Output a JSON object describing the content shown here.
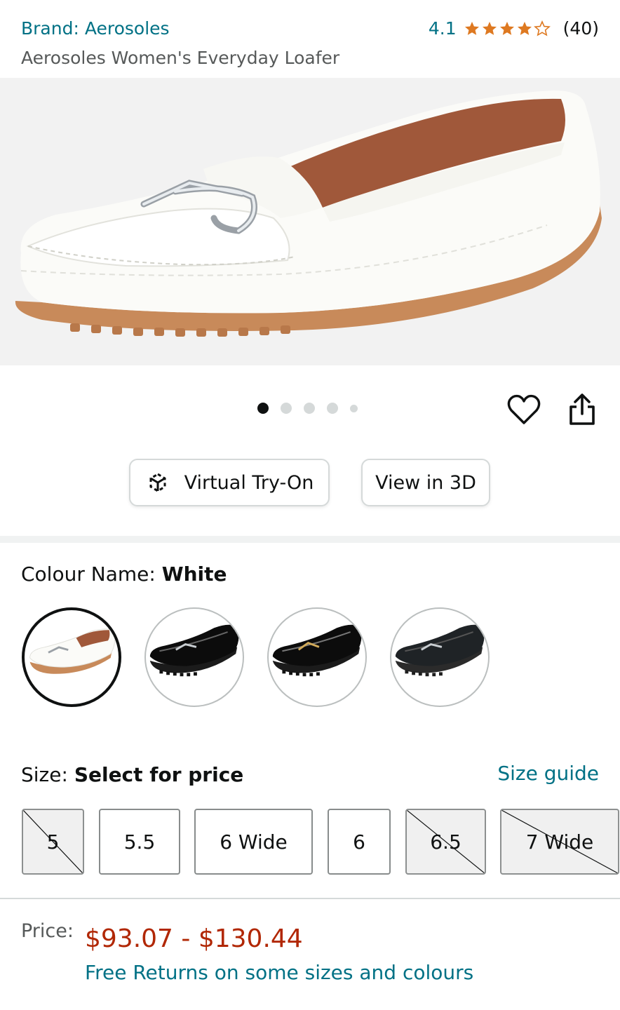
{
  "header": {
    "brand": "Brand: Aerosoles",
    "rating_value": "4.1",
    "rating_stars": 4.1,
    "review_count": "(40)",
    "product_title": "Aerosoles Women's Everyday Loafer"
  },
  "gallery": {
    "image_count": 5,
    "active_index": 0,
    "hero_icon": "white-loafer-image"
  },
  "actions": {
    "wishlist_icon": "heart-icon",
    "share_icon": "share-icon",
    "virtual_try_on_label": "Virtual Try-On",
    "view_3d_label": "View in 3D"
  },
  "colour": {
    "label": "Colour Name: ",
    "selected": "White",
    "swatches": [
      "white-loafer",
      "black-patent-loafer",
      "black-patent-gold-bit-loafer",
      "black-leather-loafer"
    ]
  },
  "size": {
    "label": "Size: ",
    "value": "Select for price",
    "guide_label": "Size guide",
    "options": [
      {
        "label": "5",
        "available": false
      },
      {
        "label": "5.5",
        "available": true
      },
      {
        "label": "6 Wide",
        "available": true
      },
      {
        "label": "6",
        "available": true
      },
      {
        "label": "6.5",
        "available": false
      },
      {
        "label": "7 Wide",
        "available": false
      }
    ]
  },
  "price": {
    "label": "Price:",
    "range": "$93.07 - $130.44",
    "returns": "Free Returns on some sizes and colours"
  },
  "colors": {
    "link": "#007185",
    "price": "#b12704",
    "star": "#de7921"
  }
}
